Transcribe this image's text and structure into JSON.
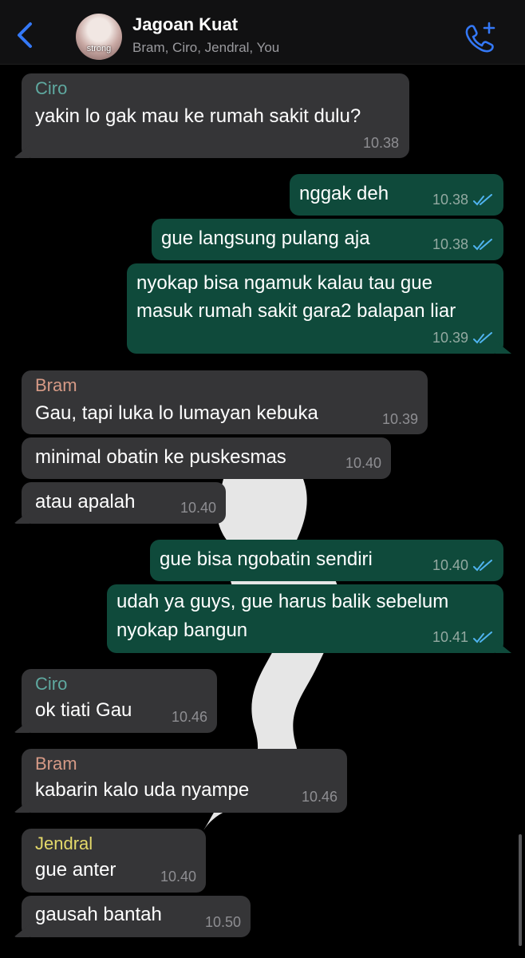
{
  "header": {
    "title": "Jagoan Kuat",
    "members": "Bram, Ciro, Jendral, You",
    "avatar_label": "strong"
  },
  "colors": {
    "incoming_bubble": "#353537",
    "outgoing_bubble": "#0f4a3b",
    "ciro": "#5fa9a0",
    "bram": "#d69a86",
    "jendral": "#e4d96a",
    "tick_read": "#4fb3ef",
    "accent": "#3478f6"
  },
  "icons": {
    "back": "chevron-left-icon",
    "call": "add-call-icon",
    "ticks": "double-check-icon"
  },
  "messages": [
    {
      "sender": "Ciro",
      "text": "yakin lo gak mau ke rumah sakit dulu?",
      "time": "10.38"
    },
    {
      "text": "nggak deh",
      "time": "10.38"
    },
    {
      "text": "gue langsung pulang aja",
      "time": "10.38"
    },
    {
      "text_line1": "nyokap bisa ngamuk kalau tau gue",
      "text_line2": "masuk rumah sakit gara2 balapan liar",
      "time": "10.39"
    },
    {
      "sender": "Bram",
      "text": "Gau, tapi luka lo lumayan kebuka",
      "time": "10.39"
    },
    {
      "text": "minimal obatin ke puskesmas",
      "time": "10.40"
    },
    {
      "text": "atau apalah",
      "time": "10.40"
    },
    {
      "text": "gue bisa ngobatin sendiri",
      "time": "10.40"
    },
    {
      "text_line1": "udah ya guys, gue harus balik sebelum",
      "text_line2": "nyokap bangun",
      "time": "10.41"
    },
    {
      "sender": "Ciro",
      "text": "ok tiati Gau",
      "time": "10.46"
    },
    {
      "sender": "Bram",
      "text": "kabarin kalo uda nyampe",
      "time": "10.46"
    },
    {
      "sender": "Jendral",
      "text": "gue anter",
      "time": "10.40"
    },
    {
      "text": "gausah bantah",
      "time": "10.50"
    }
  ]
}
